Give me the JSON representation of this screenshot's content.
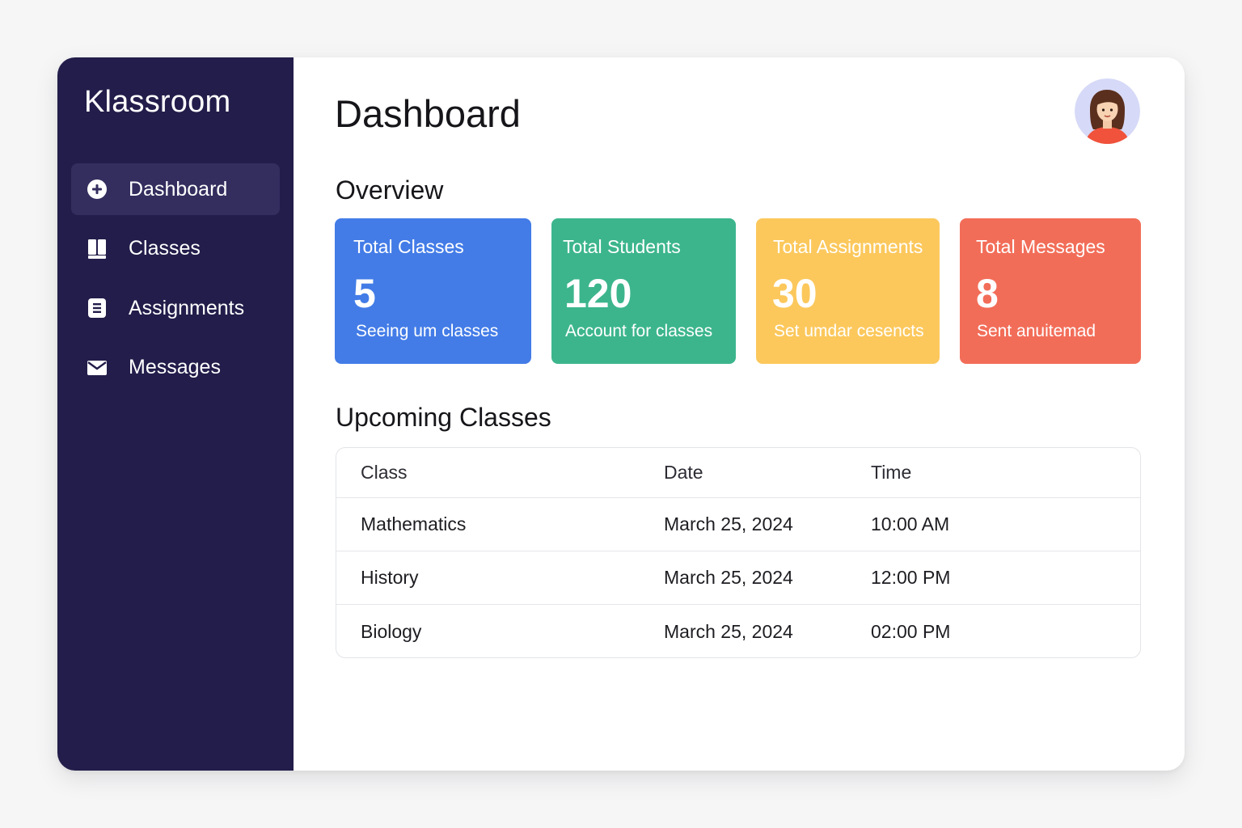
{
  "app": {
    "brand": "Klassroom"
  },
  "sidebar": {
    "items": [
      {
        "label": "Dashboard",
        "icon": "plus-circle-icon",
        "active": true
      },
      {
        "label": "Classes",
        "icon": "book-icon",
        "active": false
      },
      {
        "label": "Assignments",
        "icon": "document-icon",
        "active": false
      },
      {
        "label": "Messages",
        "icon": "envelope-icon",
        "active": false
      }
    ]
  },
  "header": {
    "title": "Dashboard",
    "avatar_icon": "user-avatar-icon"
  },
  "overview": {
    "title": "Overview",
    "cards": [
      {
        "title": "Total Classes",
        "value": "5",
        "subtitle": "Seeing um classes",
        "color": "#437ce7"
      },
      {
        "title": "Total Students",
        "value": "120",
        "subtitle": "Account for classes",
        "color": "#3cb58d"
      },
      {
        "title": "Total Assignments",
        "value": "30",
        "subtitle": "Set umdar cesencts",
        "color": "#fcc85c"
      },
      {
        "title": "Total Messages",
        "value": "8",
        "subtitle": "Sent anuitemad",
        "color": "#f26d58"
      }
    ]
  },
  "upcoming": {
    "title": "Upcoming Classes",
    "columns": [
      "Class",
      "Date",
      "Time"
    ],
    "rows": [
      [
        "Mathematics",
        "March 25, 2024",
        "10:00 AM"
      ],
      [
        "History",
        "March 25, 2024",
        "12:00 PM"
      ],
      [
        "Biology",
        "March 25, 2024",
        "02:00 PM"
      ]
    ]
  },
  "colors": {
    "sidebar_bg": "#221d4a",
    "sidebar_active": "#332e5e"
  }
}
